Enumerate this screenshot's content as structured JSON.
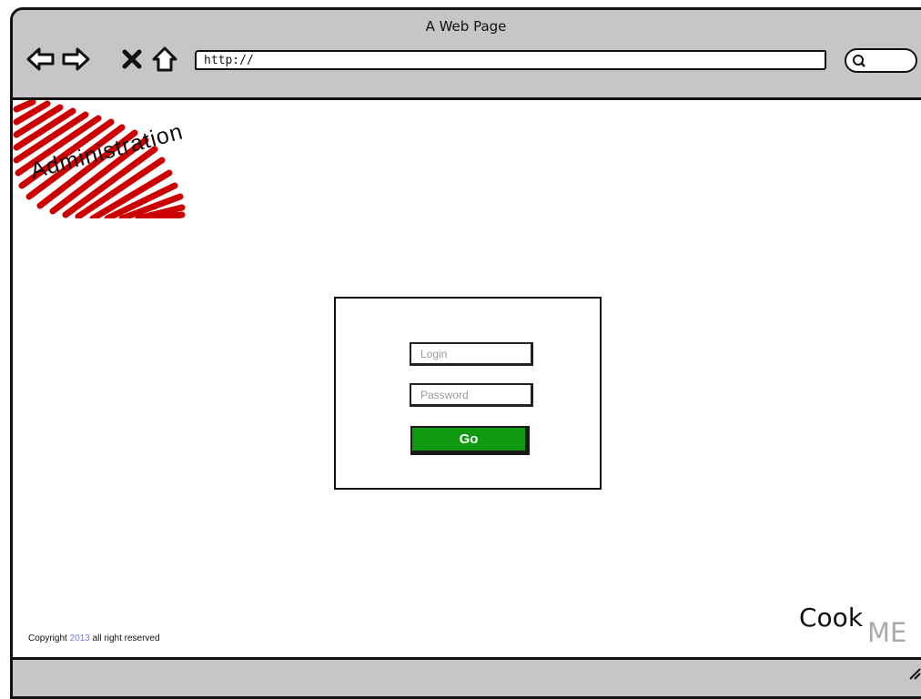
{
  "browser": {
    "window_title": "A Web Page",
    "address": "http://",
    "nav_icons": [
      "back-arrow-icon",
      "forward-arrow-icon",
      "stop-icon",
      "home-icon"
    ],
    "search_icon": "search-icon"
  },
  "brand": {
    "logo_text": "Administration",
    "scribble_color": "#cc0000"
  },
  "login": {
    "login_placeholder": "Login",
    "password_placeholder": "Password",
    "go_label": "Go",
    "go_color": "#119911"
  },
  "footer": {
    "copyright_prefix": "Copyright",
    "copyright_year": "2013",
    "copyright_suffix": "all right reserved",
    "logo_cook": "Cook",
    "logo_me": "ME"
  }
}
